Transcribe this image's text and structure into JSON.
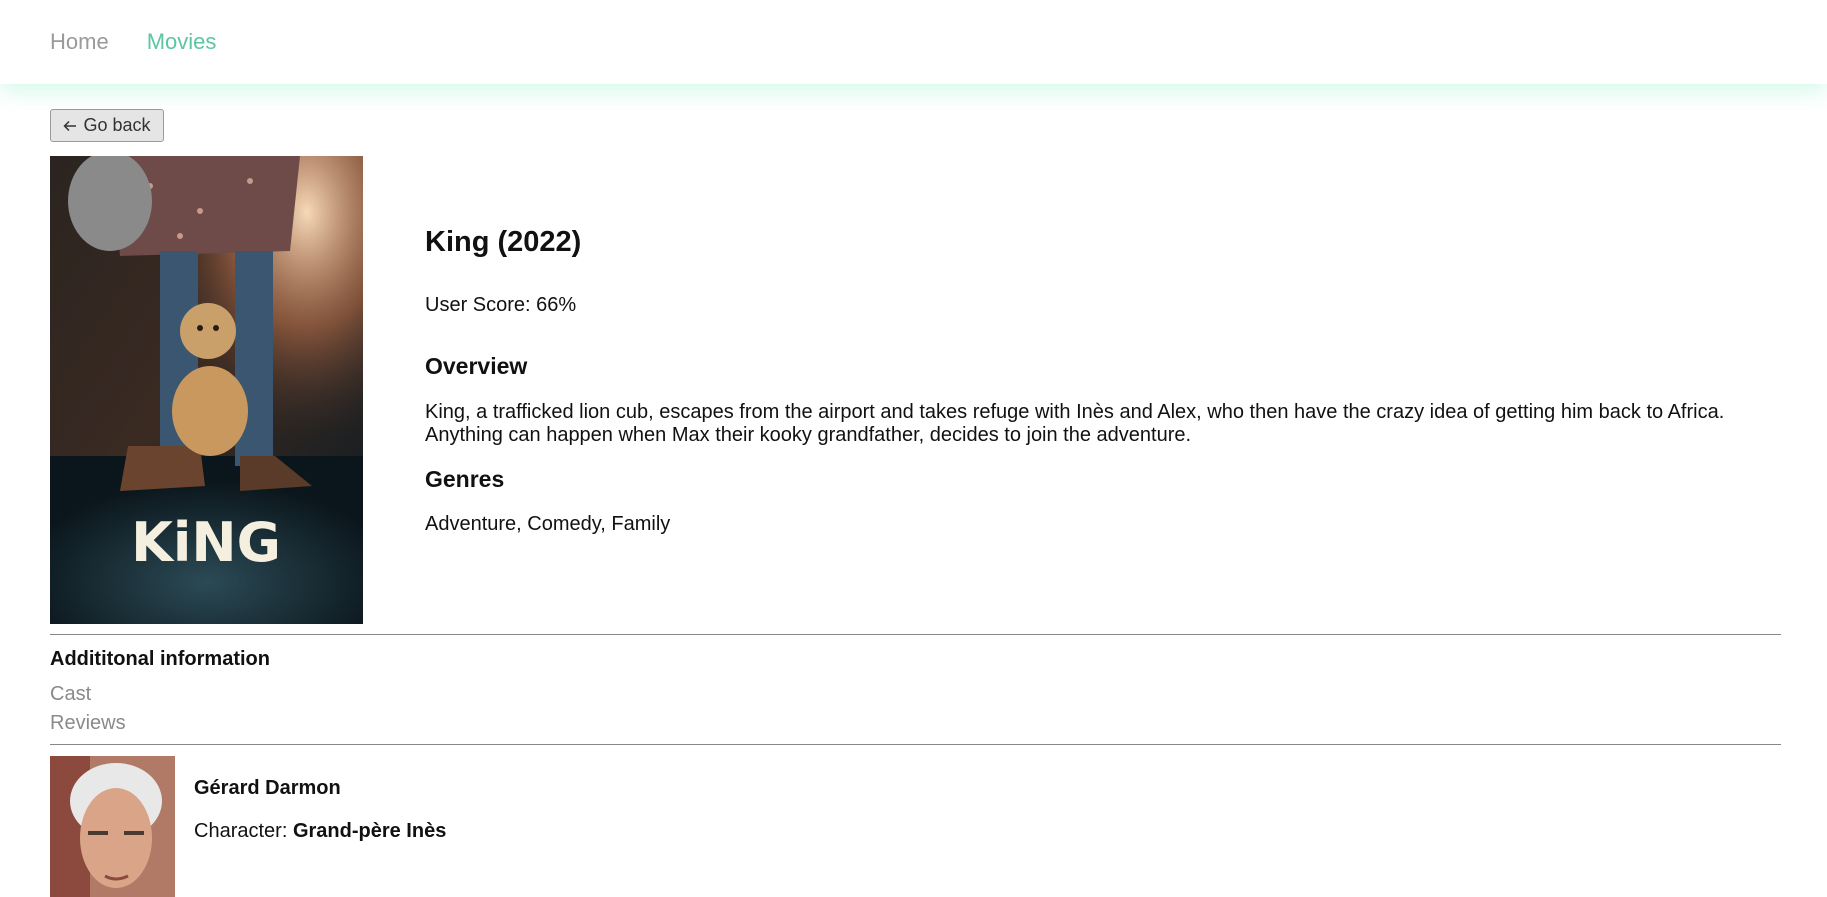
{
  "nav": {
    "home_label": "Home",
    "movies_label": "Movies"
  },
  "back_button": {
    "label": "Go back"
  },
  "movie": {
    "title": "King (2022)",
    "user_score_label": "User Score: ",
    "user_score": "66%",
    "overview_heading": "Overview",
    "overview": "King, a trafficked lion cub, escapes from the airport and takes refuge with Inès and Alex, who then have the crazy idea of getting him back to Africa. Anything can happen when Max their kooky grandfather, decides to join the adventure.",
    "genres_heading": "Genres",
    "genres": "Adventure, Comedy, Family",
    "poster_text": "KiNG"
  },
  "additional": {
    "title": "Addititonal information",
    "links": [
      "Cast",
      "Reviews"
    ]
  },
  "cast": [
    {
      "name": "Gérard Darmon",
      "character_label": "Character: ",
      "character": "Grand-père Inès"
    }
  ],
  "colors": {
    "accent": "#5cc6a0",
    "muted": "#8a8a8a"
  }
}
